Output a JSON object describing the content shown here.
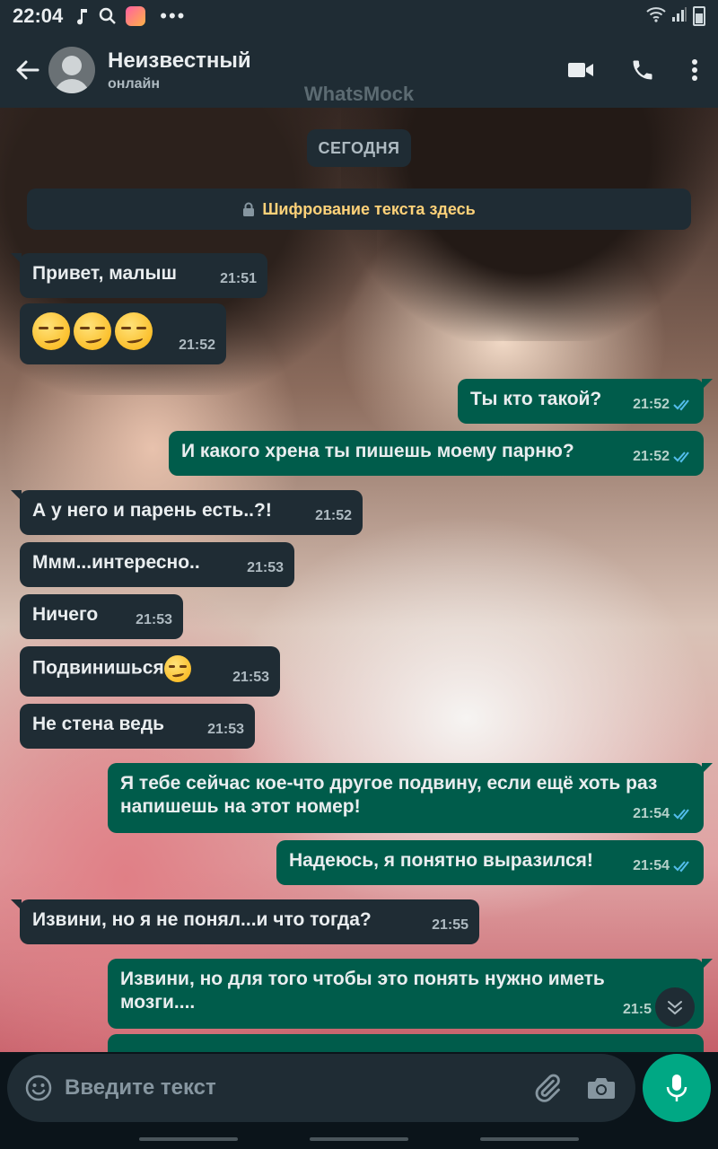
{
  "status_bar": {
    "time": "22:04",
    "icons": [
      "music-note-icon",
      "search-icon",
      "app-icon",
      "more-dots-icon",
      "wifi-icon",
      "signal-icon",
      "battery-icon"
    ],
    "dots": "•••"
  },
  "header": {
    "contact_name": "Неизвестный",
    "contact_status": "онлайн",
    "watermark": "WhatsMock"
  },
  "chat": {
    "date_label": "СЕГОДНЯ",
    "encryption_notice": "Шифрование текста здесь",
    "messages": [
      {
        "dir": "in",
        "text": "Привет, малыш",
        "time": "21:51"
      },
      {
        "dir": "in",
        "text": "",
        "emoji": [
          "smirk",
          "smirk",
          "smirk"
        ],
        "time": "21:52"
      },
      {
        "dir": "out",
        "text": "Ты кто такой?",
        "time": "21:52",
        "read": true
      },
      {
        "dir": "out",
        "text": "И какого хрена ты пишешь моему парню?",
        "time": "21:52",
        "read": true
      },
      {
        "dir": "in",
        "text": "А у него и парень есть..?!",
        "time": "21:52"
      },
      {
        "dir": "in",
        "text": "Ммм...интересно..",
        "time": "21:53"
      },
      {
        "dir": "in",
        "text": "Ничего",
        "time": "21:53"
      },
      {
        "dir": "in",
        "text": "Подвинишься",
        "emoji": [
          "smirk"
        ],
        "time": "21:53"
      },
      {
        "dir": "in",
        "text": "Не стена ведь",
        "time": "21:53"
      },
      {
        "dir": "out",
        "text": "Я тебе сейчас кое-что другое подвину, если ещё хоть раз напишешь на этот номер!",
        "time": "21:54",
        "read": true
      },
      {
        "dir": "out",
        "text": "Надеюсь, я понятно выразился!",
        "time": "21:54",
        "read": true
      },
      {
        "dir": "in",
        "text": "Извини, но я не понял...и что тогда?",
        "time": "21:55"
      },
      {
        "dir": "out",
        "text": "Извини, но для того чтобы это понять нужно иметь мозги....",
        "time": "21:5",
        "read": true
      }
    ]
  },
  "composer": {
    "placeholder": "Введите текст"
  },
  "colors": {
    "incoming_bubble": "#1f2c34",
    "outgoing_bubble": "#005c4b",
    "accent": "#00a884",
    "read_ticks": "#53bdeb",
    "encryption_text": "#ffd279"
  }
}
